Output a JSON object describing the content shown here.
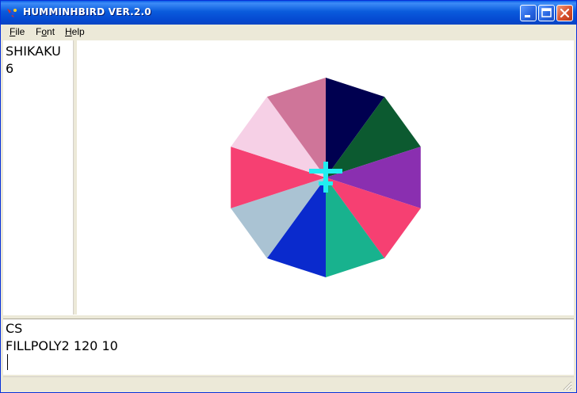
{
  "window": {
    "title": "HUMMINHBIRD VER.2.0",
    "app_icon": "hummingbird-icon",
    "controls": [
      "minimize-icon",
      "maximize-icon",
      "close-icon"
    ],
    "colors": {
      "titlebar": "#0a5bdc",
      "close": "#d8502c"
    }
  },
  "menu": {
    "file": {
      "accel": "F",
      "rest": "ile"
    },
    "font": {
      "pre": "F",
      "accel": "o",
      "rest": "nt"
    },
    "help": {
      "accel": "H",
      "rest": "elp"
    }
  },
  "side_panel": {
    "lines": [
      "SHIKAKU",
      "6"
    ]
  },
  "canvas": {
    "shape": "decagon",
    "segment_colors": [
      "#000050",
      "#0c5a30",
      "#8a2fb0",
      "#f64072",
      "#18b28e",
      "#0a2acd",
      "#aac3d3",
      "#f64072",
      "#f6d0e6",
      "#cf7599"
    ],
    "turtle_color": "#22eef0"
  },
  "console": {
    "lines": [
      "CS",
      "FILLPOLY2 120 10",
      ""
    ]
  }
}
